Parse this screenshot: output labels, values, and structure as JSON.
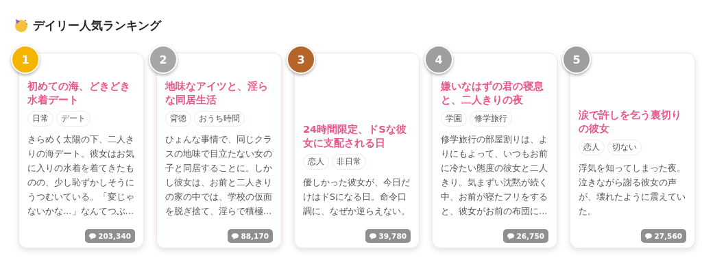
{
  "heading": "デイリー人気ランキング",
  "cards": [
    {
      "rank": "1",
      "color": "#f5b400",
      "title": "初めての海、どきどき水着デート",
      "tags": [
        "日常",
        "デート"
      ],
      "description": "きらめく太陽の下、二人きりの海デート。彼女はお気に入りの水着を着てきたものの、少し恥ずかしそうにうつむいている。「変じゃないかな…」なんてつぶ…",
      "count": "203,340"
    },
    {
      "rank": "2",
      "color": "#a6a6a6",
      "title": "地味なアイツと、淫らな同居生活",
      "tags": [
        "背徳",
        "おうち時間"
      ],
      "description": "ひょんな事情で、同じクラスの地味で目立たない女の子と同居することに。しかし彼女は、お前と二人きりの家の中では、学校の仮面を脱ぎ捨て、淫らで積極…",
      "count": "88,170"
    },
    {
      "rank": "3",
      "color": "#b5652a",
      "title": "24時間限定、ドSな彼女に支配される日",
      "tags": [
        "恋人",
        "非日常"
      ],
      "description": "優しかった彼女が、今日だけはドSになる日。命令口調に、なぜか逆らえない。",
      "count": "39,780"
    },
    {
      "rank": "4",
      "color": "#9e9e9e",
      "title": "嫌いなはずの君の寝息と、二人きりの夜",
      "tags": [
        "学園",
        "修学旅行"
      ],
      "description": "修学旅行の部屋割りは、よりにもよって、いつもお前に冷たい態度の彼女と二人きり。気まずい沈黙が続く中、お前が寝たフリをすると、彼女がお前の布団に…",
      "count": "26,750"
    },
    {
      "rank": "5",
      "color": "#9e9e9e",
      "title": "涙で許しを乞う裏切りの彼女",
      "tags": [
        "恋人",
        "切ない"
      ],
      "description": "浮気を知ってしまった夜。泣きながら謝る彼女の声が、壊れたように震えていた。",
      "count": "27,560"
    }
  ]
}
